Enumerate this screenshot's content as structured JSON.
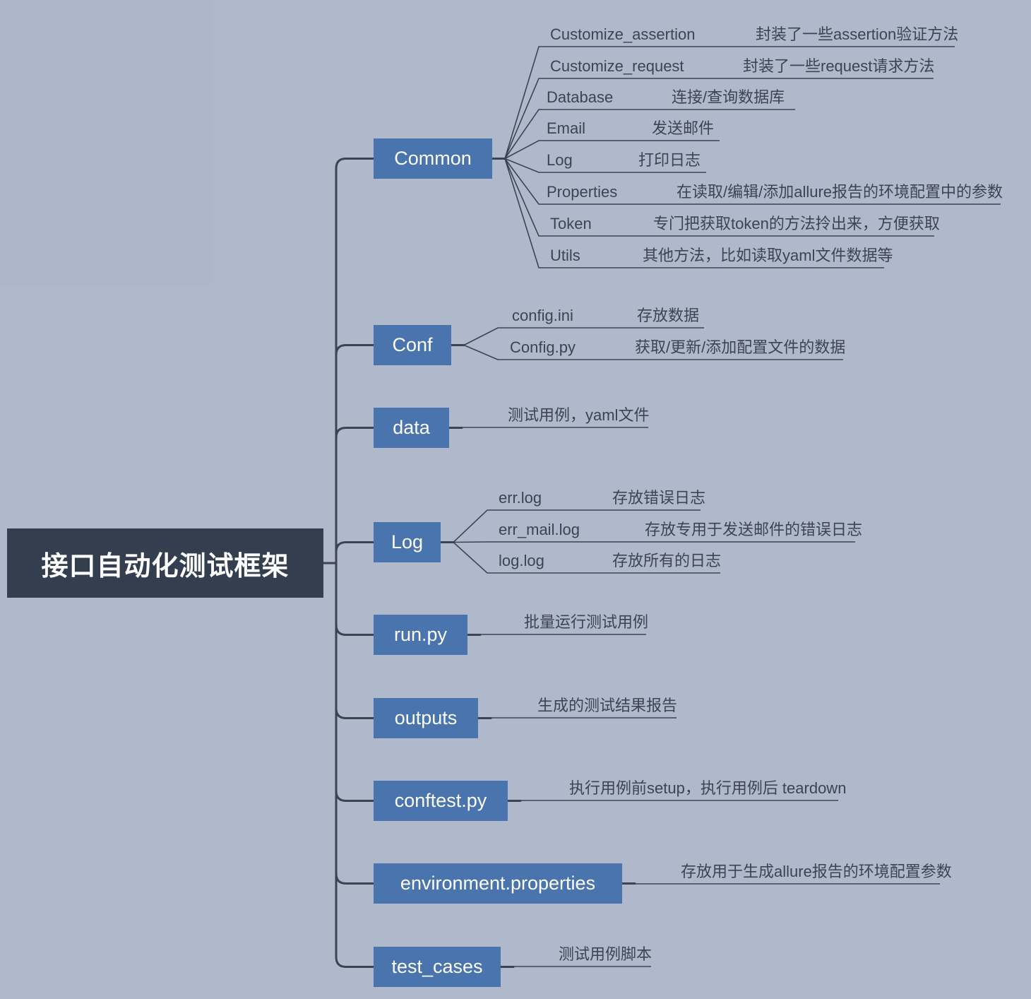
{
  "colors": {
    "background": "#b0b9cb",
    "root_fill": "#333e4f",
    "branch_fill": "#4a74ae",
    "text_dark": "#3b4450",
    "text_light": "#ffffff",
    "line": "#3b4450"
  },
  "root": {
    "label": "接口自动化测试框架"
  },
  "branches": [
    {
      "id": "common",
      "label": "Common",
      "children": [
        {
          "label": "Customize_assertion",
          "desc": "封装了一些assertion验证方法"
        },
        {
          "label": "Customize_request",
          "desc": "封装了一些request请求方法"
        },
        {
          "label": "Database",
          "desc": "连接/查询数据库"
        },
        {
          "label": "Email",
          "desc": "发送邮件"
        },
        {
          "label": "Log",
          "desc": "打印日志"
        },
        {
          "label": "Properties",
          "desc": "在读取/编辑/添加allure报告的环境配置中的参数"
        },
        {
          "label": "Token",
          "desc": "专门把获取token的方法拎出来，方便获取"
        },
        {
          "label": "Utils",
          "desc": "其他方法，比如读取yaml文件数据等"
        }
      ]
    },
    {
      "id": "conf",
      "label": "Conf",
      "children": [
        {
          "label": "config.ini",
          "desc": "存放数据"
        },
        {
          "label": "Config.py",
          "desc": "获取/更新/添加配置文件的数据"
        }
      ]
    },
    {
      "id": "data",
      "label": "data",
      "children": [
        {
          "label": "",
          "desc": "测试用例，yaml文件"
        }
      ]
    },
    {
      "id": "log",
      "label": "Log",
      "children": [
        {
          "label": "err.log",
          "desc": "存放错误日志"
        },
        {
          "label": "err_mail.log",
          "desc": "存放专用于发送邮件的错误日志"
        },
        {
          "label": "log.log",
          "desc": "存放所有的日志"
        }
      ]
    },
    {
      "id": "runpy",
      "label": "run.py",
      "children": [
        {
          "label": "",
          "desc": "批量运行测试用例"
        }
      ]
    },
    {
      "id": "outputs",
      "label": "outputs",
      "children": [
        {
          "label": "",
          "desc": "生成的测试结果报告"
        }
      ]
    },
    {
      "id": "conftestpy",
      "label": "conftest.py",
      "children": [
        {
          "label": "",
          "desc": "执行用例前setup，执行用例后 teardown"
        }
      ]
    },
    {
      "id": "envprops",
      "label": "environment.properties",
      "children": [
        {
          "label": "",
          "desc": "存放用于生成allure报告的环境配置参数"
        }
      ]
    },
    {
      "id": "testcases",
      "label": "test_cases",
      "children": [
        {
          "label": "",
          "desc": "测试用例脚本"
        }
      ]
    }
  ]
}
